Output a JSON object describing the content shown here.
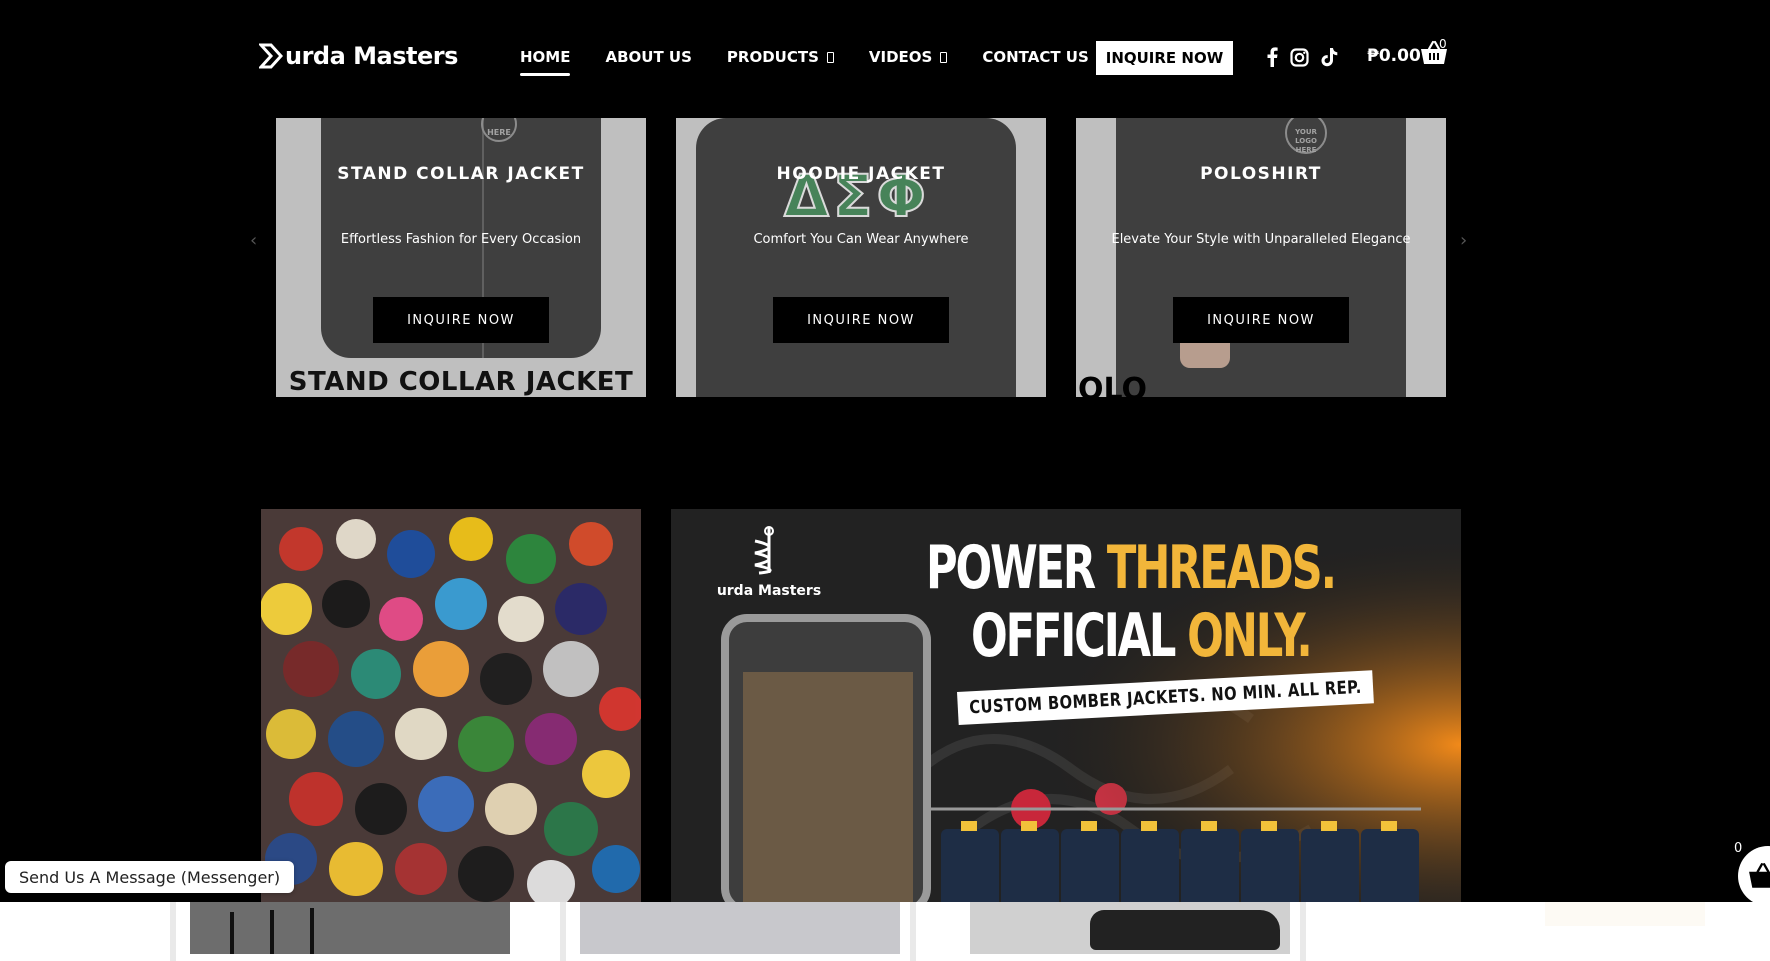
{
  "header": {
    "logo_text": "urda Masters",
    "nav": [
      {
        "label": "HOME",
        "active": true,
        "dropdown": false
      },
      {
        "label": "ABOUT US",
        "active": false,
        "dropdown": false
      },
      {
        "label": "PRODUCTS",
        "active": false,
        "dropdown": true
      },
      {
        "label": "VIDEOS",
        "active": false,
        "dropdown": true
      },
      {
        "label": "CONTACT US",
        "active": false,
        "dropdown": false
      }
    ],
    "inquire_label": "INQUIRE NOW",
    "social_icons": [
      "facebook-icon",
      "instagram-icon",
      "tiktok-icon"
    ],
    "cart_amount": "₱0.00",
    "cart_count": "0"
  },
  "products": [
    {
      "title": "STAND COLLAR JACKET",
      "subtitle": "Effortless Fashion for Every Occasion",
      "button": "INQUIRE NOW",
      "caption": "STAND COLLAR JACKET",
      "badge": "HERE"
    },
    {
      "title": "HOODIE JACKET",
      "subtitle": "Comfort You Can Wear Anywhere",
      "button": "INQUIRE NOW",
      "caption": "",
      "badge": "ΔΣΦ"
    },
    {
      "title": "POLOSHIRT",
      "subtitle": "Elevate Your Style with Unparalleled Elegance",
      "button": "INQUIRE NOW",
      "caption": "OLO",
      "badge": "YOUR LOGO HERE"
    }
  ],
  "carousel_arrows": {
    "prev": "‹",
    "next": "›"
  },
  "banner": {
    "logo_text": "urda Masters",
    "headline_1a": "POWER ",
    "headline_1b": "THREADS.",
    "headline_2a": "OFFICIAL ",
    "headline_2b": "ONLY.",
    "tagline": "CUSTOM BOMBER JACKETS. NO MIN. ALL REP."
  },
  "messenger_label": "Send Us A Message (Messenger)",
  "floating_cart_count": "0",
  "colors": {
    "accent_gold": "#f2b63a",
    "background": "#000000"
  }
}
